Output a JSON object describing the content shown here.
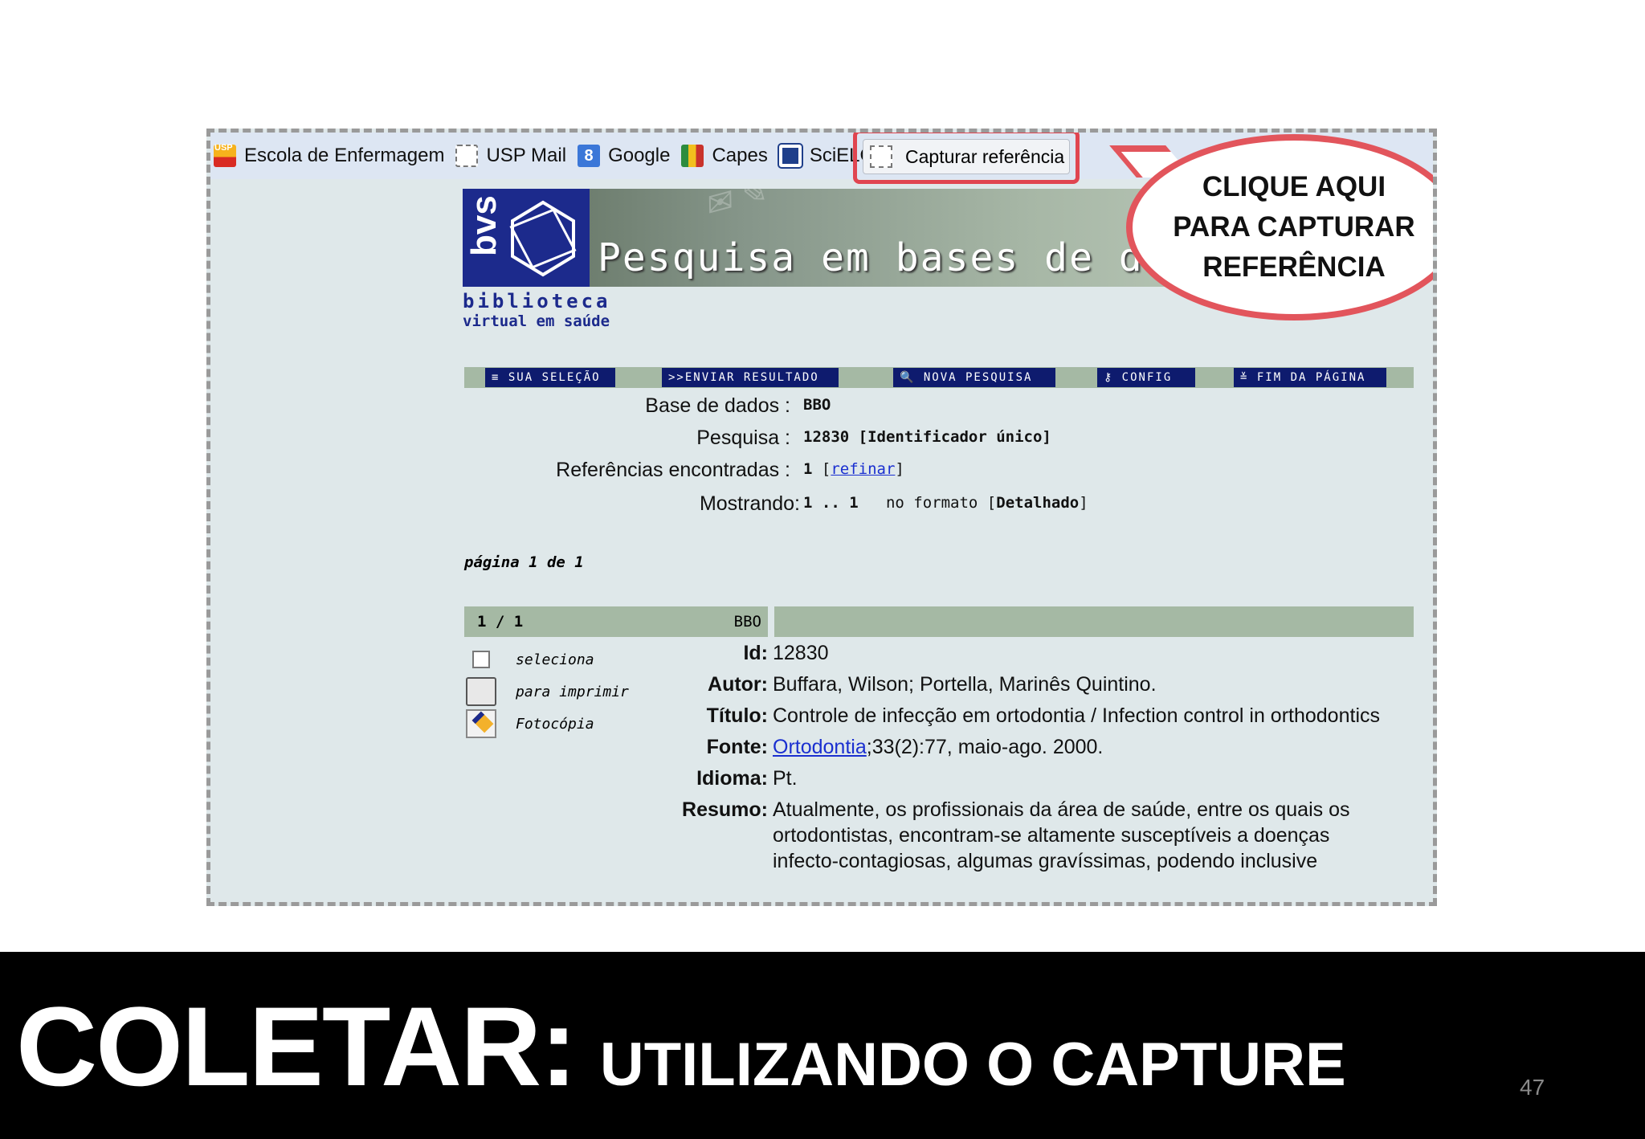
{
  "bookmarks": [
    {
      "label": "Escola de Enfermagem",
      "icon": "usp-logo-icon"
    },
    {
      "label": "USP Mail",
      "icon": "blank-page-icon"
    },
    {
      "label": "Google",
      "icon": "google-icon"
    },
    {
      "label": "Capes",
      "icon": "capes-icon"
    },
    {
      "label": "SciELO",
      "icon": "scielo-icon"
    }
  ],
  "capture_button": {
    "label": "Capturar referência",
    "icon": "blank-page-icon",
    "highlight_color": "#e04550"
  },
  "banner": {
    "logo_text": "bvs",
    "title": "Pesquisa em bases de dados",
    "caption_line1": "biblioteca",
    "caption_line2": "virtual em saúde"
  },
  "callout": {
    "lines": [
      "CLIQUE AQUI",
      "PARA CAPTURAR",
      "REFERÊNCIA"
    ],
    "border_color": "#e2555c"
  },
  "nav": [
    "≡ SUA SELEÇÃO",
    ">>ENVIAR RESULTADO",
    "🔍 NOVA PESQUISA",
    "⚷ CONFIG",
    "≚ FIM DA PÁGINA"
  ],
  "search_info": {
    "base_label": "Base de dados :",
    "base_value": "BBO",
    "pesquisa_label": "Pesquisa :",
    "pesquisa_value": "12830 [Identificador único]",
    "refs_label": "Referências encontradas :",
    "refs_value": "1",
    "refinar": "refinar",
    "mostrando_label": "Mostrando:",
    "mostrando_value": "1 .. 1",
    "formato_text": "no formato",
    "formato_value": "Detalhado"
  },
  "pagination": "página 1 de 1",
  "result": {
    "number": "1 / 1",
    "db": "BBO",
    "actions": [
      "seleciona",
      "para imprimir",
      "Fotocópia"
    ],
    "fields": {
      "id_label": "Id:",
      "id": "12830",
      "autor_label": "Autor:",
      "autor": "Buffara, Wilson; Portella, Marinês Quintino.",
      "titulo_label": "Título:",
      "titulo": "Controle de infecção em ortodontia / Infection control in orthodontics",
      "fonte_label": "Fonte:",
      "fonte_link": "Ortodontia",
      "fonte_rest": ";33(2):77, maio-ago. 2000.",
      "idioma_label": "Idioma:",
      "idioma": "Pt.",
      "resumo_label": "Resumo:",
      "resumo": "Atualmente, os profissionais da área de saúde, entre os quais os ortodontistas, encontram-se altamente susceptíveis a doenças infecto-contagiosas, algumas gravíssimas, podendo inclusive"
    }
  },
  "slide": {
    "title_big": "COLETAR:",
    "title_small": "UTILIZANDO O CAPTURE",
    "page_number": "47"
  }
}
